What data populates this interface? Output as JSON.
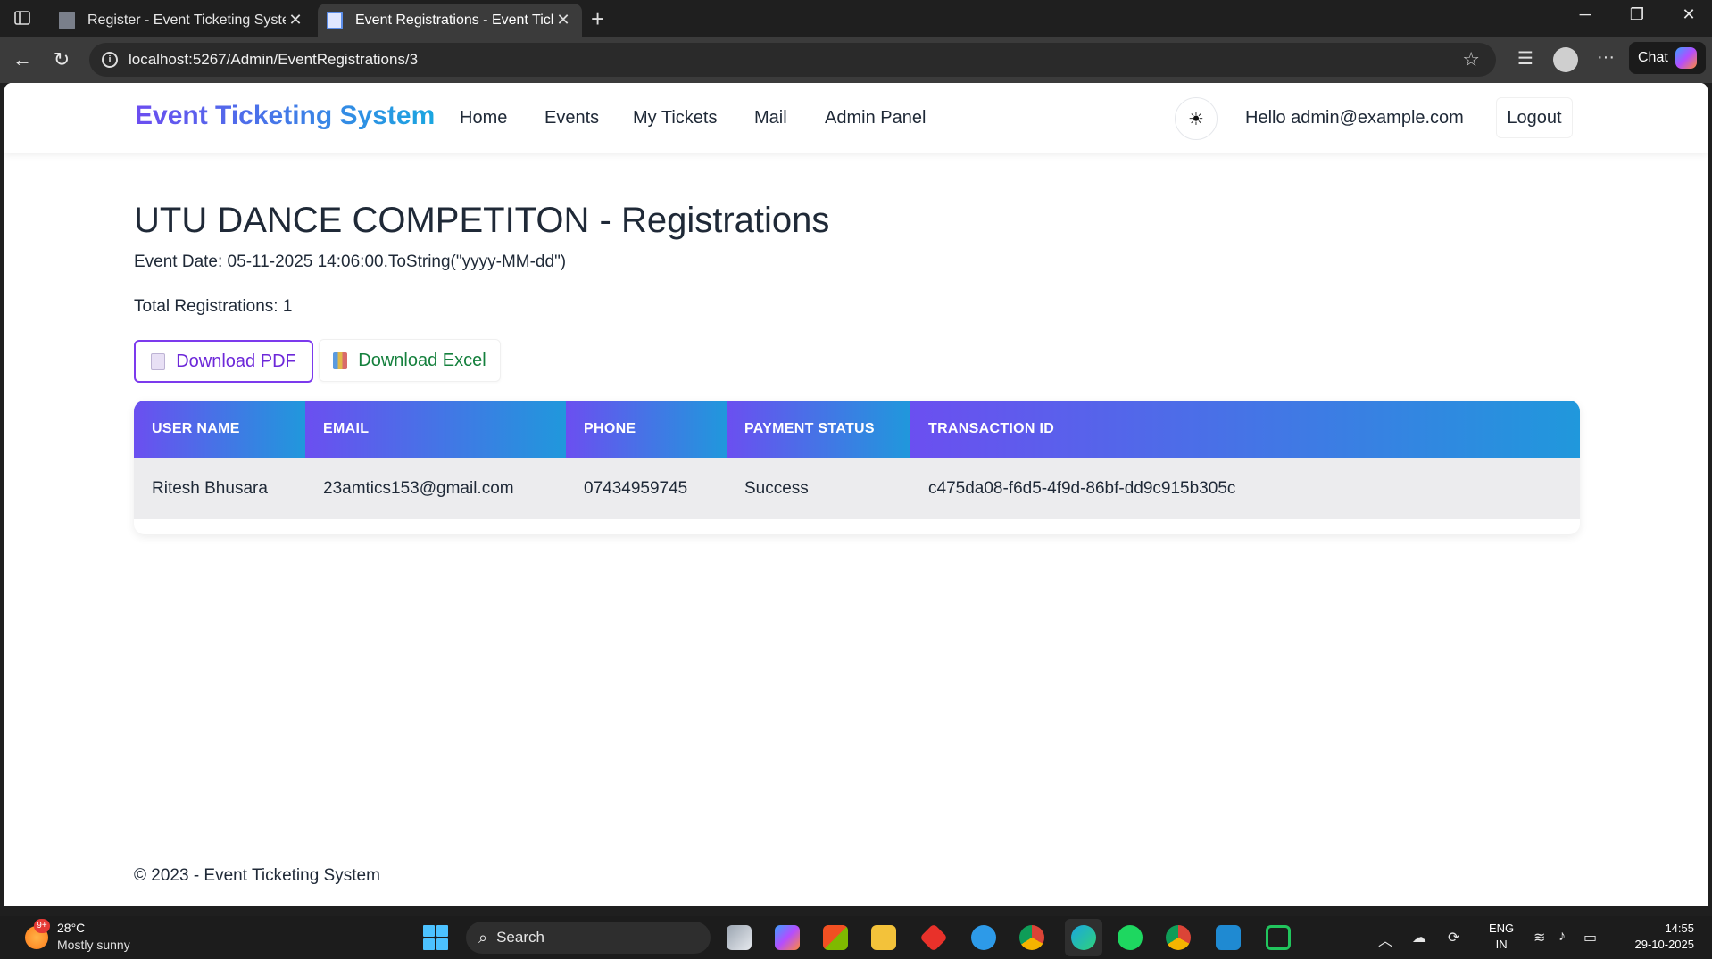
{
  "browser": {
    "tabs": [
      {
        "title": "Register - Event Ticketing System",
        "active": false
      },
      {
        "title": "Event Registrations - Event Ticket",
        "active": true
      }
    ],
    "url": "localhost:5267/Admin/EventRegistrations/3",
    "chat_label": "Chat"
  },
  "nav": {
    "brand": "Event Ticketing System",
    "links": [
      "Home",
      "Events",
      "My Tickets",
      "Mail",
      "Admin Panel"
    ],
    "theme_icon": "sun-icon",
    "greeting": "Hello admin@example.com",
    "logout": "Logout"
  },
  "main": {
    "title": "UTU DANCE COMPETITON - Registrations",
    "event_date": "Event Date: 05-11-2025 14:06:00.ToString(\"yyyy-MM-dd\")",
    "total": "Total Registrations: 1",
    "download_pdf": "Download PDF",
    "download_excel": "Download Excel",
    "table": {
      "headers": [
        "USER NAME",
        "EMAIL",
        "PHONE",
        "PAYMENT STATUS",
        "TRANSACTION ID"
      ],
      "rows": [
        [
          "Ritesh Bhusara",
          "23amtics153@gmail.com",
          "07434959745",
          "Success",
          "c475da08-f6d5-4f9d-86bf-dd9c915b305c"
        ]
      ]
    }
  },
  "footer": {
    "text": "© 2023 - Event Ticketing System"
  },
  "taskbar": {
    "weather_badge": "9+",
    "temperature": "28°C",
    "condition": "Mostly sunny",
    "search_label": "Search",
    "lang_top": "ENG",
    "lang_bottom": "IN",
    "time": "14:55",
    "date": "29-10-2025"
  },
  "colors": {
    "brand_gradient": [
      "#6c4df0",
      "#1aa6e0"
    ],
    "pdf_accent": "#7c3aed",
    "excel_accent": "#15803d"
  }
}
